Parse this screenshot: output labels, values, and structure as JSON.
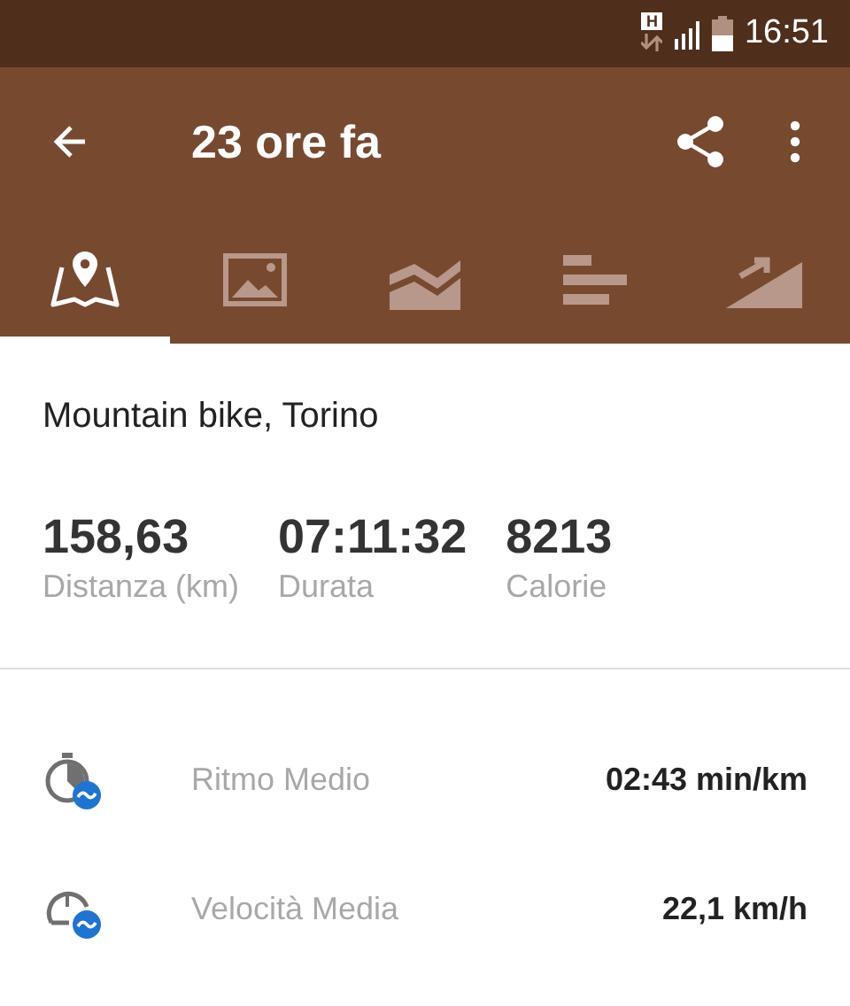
{
  "status_bar": {
    "network_badge": "H",
    "time": "16:51"
  },
  "toolbar": {
    "title": "23 ore fa"
  },
  "tabs": [
    {
      "kind": "map",
      "selected": true
    },
    {
      "kind": "photo",
      "selected": false
    },
    {
      "kind": "chart",
      "selected": false
    },
    {
      "kind": "splits",
      "selected": false
    },
    {
      "kind": "elevation",
      "selected": false
    }
  ],
  "activity": {
    "name": "Mountain bike, Torino"
  },
  "stats": [
    {
      "value": "158,63",
      "label": "Distanza (km)"
    },
    {
      "value": "07:11:32",
      "label": "Durata"
    },
    {
      "value": "8213",
      "label": "Calorie"
    }
  ],
  "metrics": [
    {
      "kind": "pace",
      "label": "Ritmo Medio",
      "value": "02:43 min/km"
    },
    {
      "kind": "speed",
      "label": "Velocità Media",
      "value": "22,1 km/h"
    }
  ]
}
